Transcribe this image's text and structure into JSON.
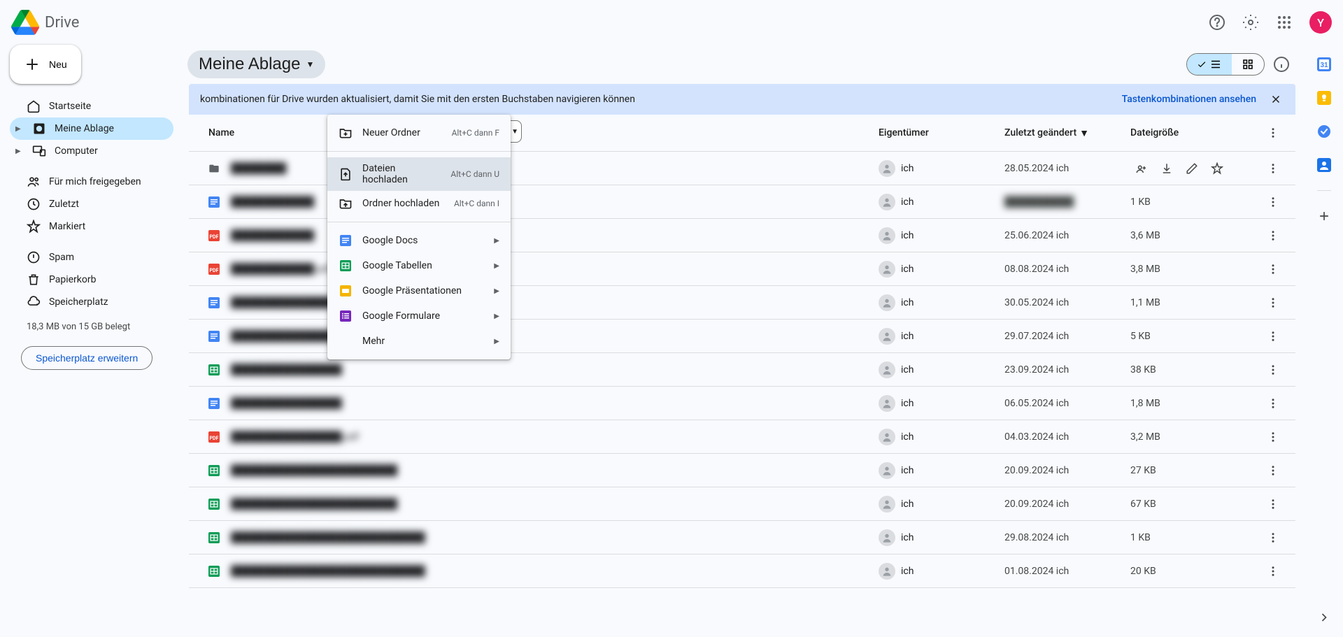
{
  "header": {
    "app_title": "Drive",
    "avatar_letter": "Y"
  },
  "sidebar": {
    "new_label": "Neu",
    "items": [
      {
        "label": "Startseite",
        "icon": "home"
      },
      {
        "label": "Meine Ablage",
        "icon": "drive",
        "selected": true
      },
      {
        "label": "Computer",
        "icon": "devices"
      },
      {
        "label": "Für mich freigegeben",
        "icon": "people"
      },
      {
        "label": "Zuletzt",
        "icon": "clock"
      },
      {
        "label": "Markiert",
        "icon": "star"
      },
      {
        "label": "Spam",
        "icon": "spam"
      },
      {
        "label": "Papierkorb",
        "icon": "trash"
      },
      {
        "label": "Speicherplatz",
        "icon": "cloud"
      }
    ],
    "storage_text": "18,3 MB von 15 GB belegt",
    "storage_expand": "Speicherplatz erweitern"
  },
  "main": {
    "breadcrumb": "Meine Ablage",
    "banner": {
      "text": "kombinationen für Drive wurden aktualisiert, damit Sie mit den ersten Buchstaben navigieren können",
      "link": "Tastenkombinationen ansehen"
    },
    "columns": {
      "name": "Name",
      "owner": "Eigentümer",
      "modified": "Zuletzt geändert",
      "size": "Dateigröße"
    }
  },
  "context_menu": {
    "new_folder": "Neuer Ordner",
    "new_folder_shortcut": "Alt+C dann F",
    "upload_file": "Dateien hochladen",
    "upload_file_shortcut": "Alt+C dann U",
    "upload_folder": "Ordner hochladen",
    "upload_folder_shortcut": "Alt+C dann I",
    "google_docs": "Google Docs",
    "google_sheets": "Google Tabellen",
    "google_slides": "Google Präsentationen",
    "google_forms": "Google Formulare",
    "more": "Mehr"
  },
  "files": [
    {
      "name": "████████",
      "type": "folder",
      "owner": "ich",
      "modified": "28.05.2024 ich",
      "size": "—",
      "selected": true
    },
    {
      "name": "████████████",
      "type": "doc",
      "owner": "ich",
      "modified": "██████████",
      "modified_blur": true,
      "size": "1 KB"
    },
    {
      "name": "████████████",
      "type": "pdf",
      "owner": "ich",
      "modified": "25.06.2024 ich",
      "size": "3,6 MB"
    },
    {
      "name": "████████████.pdf",
      "type": "pdf",
      "owner": "ich",
      "modified": "08.08.2024 ich",
      "size": "3,8 MB"
    },
    {
      "name": "████████████████████",
      "type": "doc",
      "owner": "ich",
      "modified": "30.05.2024 ich",
      "size": "1,1 MB"
    },
    {
      "name": "████████████████████████",
      "type": "doc",
      "owner": "ich",
      "modified": "29.07.2024 ich",
      "size": "5 KB",
      "shared": true
    },
    {
      "name": "████████████████",
      "type": "sheet",
      "owner": "ich",
      "modified": "23.09.2024 ich",
      "size": "38 KB"
    },
    {
      "name": "████████████████",
      "type": "doc",
      "owner": "ich",
      "modified": "06.05.2024 ich",
      "size": "1,8 MB"
    },
    {
      "name": "████████████████.pdf",
      "type": "pdf",
      "owner": "ich",
      "modified": "04.03.2024 ich",
      "size": "3,2 MB"
    },
    {
      "name": "████████████████████████",
      "type": "sheet",
      "owner": "ich",
      "modified": "20.09.2024 ich",
      "size": "27 KB"
    },
    {
      "name": "████████████████████████",
      "type": "sheet",
      "owner": "ich",
      "modified": "20.09.2024 ich",
      "size": "67 KB"
    },
    {
      "name": "████████████████████████████",
      "type": "sheet",
      "owner": "ich",
      "modified": "29.08.2024 ich",
      "size": "1 KB"
    },
    {
      "name": "████████████████████████████",
      "type": "sheet",
      "owner": "ich",
      "modified": "01.08.2024 ich",
      "size": "20 KB"
    }
  ]
}
